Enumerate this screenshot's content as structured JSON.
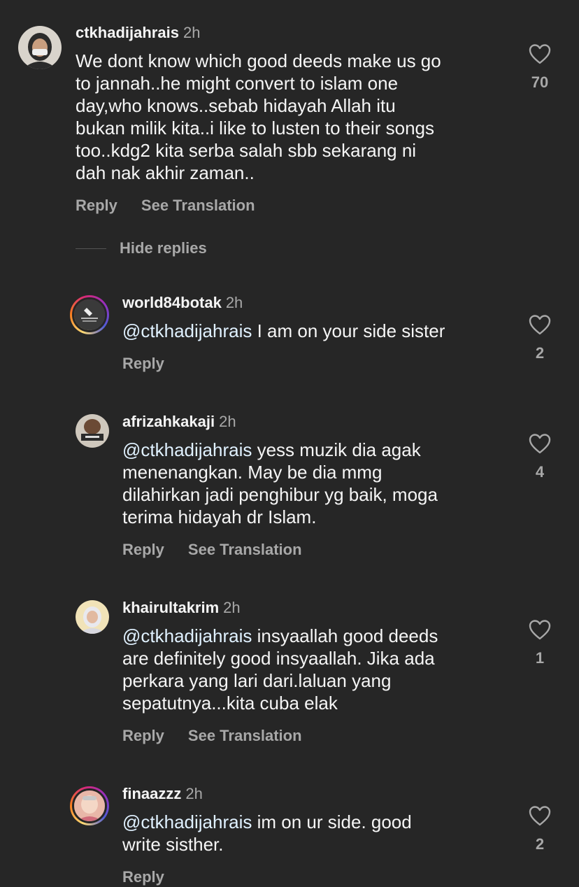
{
  "parent": {
    "username": "ctkhadijahrais",
    "time": "2h",
    "text": "We dont know which good deeds make us go\nto jannah..he might convert to islam one\nday,who knows..sebab hidayah Allah itu\nbukan milik kita..i like to lusten to their songs\ntoo..kdg2 kita serba salah sbb sekarang ni\ndah nak akhir zaman..",
    "likes": "70",
    "reply_label": "Reply",
    "translate_label": "See Translation",
    "like_icon": "heart-icon"
  },
  "hide_replies_label": "Hide replies",
  "replies": [
    {
      "username": "world84botak",
      "time": "2h",
      "mention": "@ctkhadijahrais",
      "text": " I am on your side sister",
      "likes": "2",
      "reply_label": "Reply"
    },
    {
      "username": "afrizahkakaji",
      "time": "2h",
      "mention": "@ctkhadijahrais",
      "text": " yess muzik dia agak\nmenenangkan.  May be dia mmg\ndilahirkan jadi penghibur yg baik, moga\nterima hidayah dr Islam.",
      "likes": "4",
      "reply_label": "Reply",
      "translate_label": "See Translation"
    },
    {
      "username": "khairultakrim",
      "time": "2h",
      "mention": "@ctkhadijahrais",
      "text": " insyaallah good deeds\nare definitely good insyaallah. Jika ada\nperkara yang lari dari.laluan yang\nsepatutnya...kita cuba elak",
      "likes": "1",
      "reply_label": "Reply",
      "translate_label": "See Translation"
    },
    {
      "username": "finaazzz",
      "time": "2h",
      "mention": "@ctkhadijahrais",
      "text": " im on ur side. good\nwrite sisther.",
      "likes": "2",
      "reply_label": "Reply"
    }
  ],
  "colors": {
    "background": "#262626",
    "primary_text": "#f5f5f5",
    "secondary_text": "#a8a8a8",
    "mention": "#e0f1ff"
  }
}
